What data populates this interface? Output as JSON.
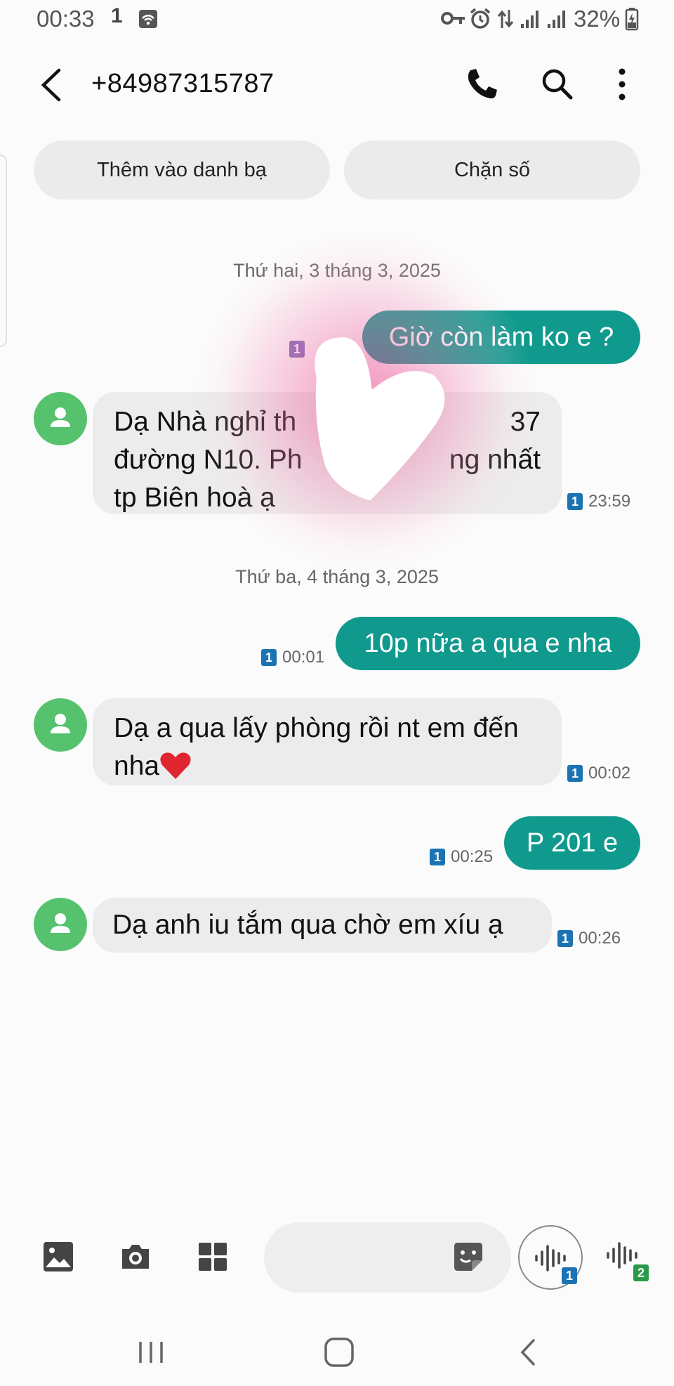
{
  "status_bar": {
    "time": "00:33",
    "notif_text": "1",
    "battery_pct": "32%",
    "icons": [
      "wifi-icon",
      "key-icon",
      "alarm-icon",
      "data-arrows-icon",
      "signal-icon",
      "signal-icon",
      "battery-charging-icon"
    ]
  },
  "header": {
    "title": "+84987315787",
    "icons": [
      "back-arrow-icon",
      "phone-icon",
      "search-icon",
      "more-vert-icon"
    ]
  },
  "actions": {
    "add_contact": "Thêm vào danh bạ",
    "block": "Chặn số"
  },
  "conversation": {
    "date1": "Thứ hai, 3 tháng 3, 2025",
    "date2": "Thứ ba, 4 tháng 3, 2025",
    "messages": [
      {
        "dir": "out",
        "text": "Giờ còn làm ko e ?",
        "sim": "1",
        "time": ""
      },
      {
        "dir": "in",
        "line1": "Dạ Nhà nghỉ th",
        "line1b": "37",
        "line2": "đường N10. Ph",
        "line2b": "ng nhất",
        "line3": "tp Biên hoà ạ",
        "sim": "1",
        "time": "23:59"
      },
      {
        "dir": "out",
        "text": "10p nữa a qua e nha",
        "sim": "1",
        "time": "00:01"
      },
      {
        "dir": "in",
        "line1": "Dạ a qua lấy phòng rồi nt em đến",
        "line2": "nha",
        "sim": "1",
        "time": "00:02"
      },
      {
        "dir": "out",
        "text": "P 201 e",
        "sim": "1",
        "time": "00:25"
      },
      {
        "dir": "in",
        "line1": "Dạ anh iu tắm qua chờ em xíu ạ",
        "sim": "1",
        "time": "00:26"
      }
    ]
  },
  "input_bar": {
    "icons": [
      "gallery-icon",
      "camera-icon",
      "apps-grid-icon",
      "sticker-icon",
      "voice-sim1-icon",
      "voice-sim2-icon"
    ],
    "voice1_sim": "1",
    "voice2_sim": "2"
  },
  "nav_bar": {
    "icons": [
      "recents-icon",
      "home-icon",
      "back-nav-icon"
    ]
  },
  "colors": {
    "outgoing_bubble": "#109a8e",
    "incoming_bubble": "#ececec",
    "avatar": "#56c26e",
    "sim_badge": "#1b73b3"
  }
}
